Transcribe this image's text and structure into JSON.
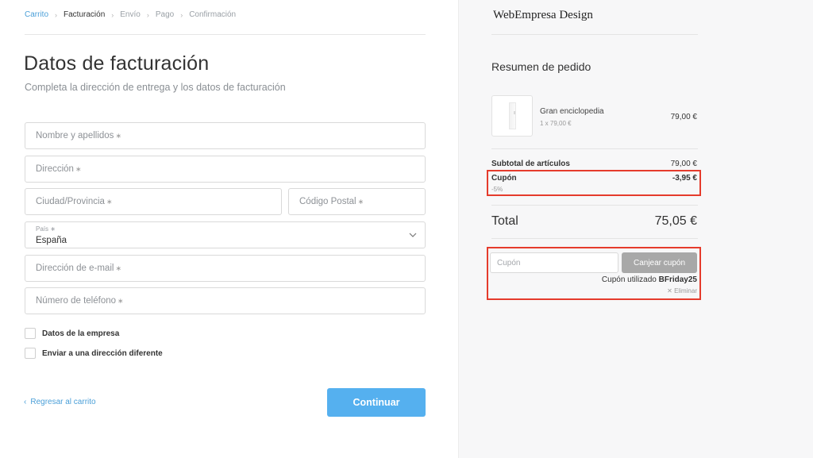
{
  "breadcrumb": [
    {
      "label": "Carrito",
      "state": "link"
    },
    {
      "label": "Facturación",
      "state": "active"
    },
    {
      "label": "Envío",
      "state": "inactive"
    },
    {
      "label": "Pago",
      "state": "inactive"
    },
    {
      "label": "Confirmación",
      "state": "inactive"
    }
  ],
  "form": {
    "title": "Datos de facturación",
    "subtitle": "Completa la dirección de entrega y los datos de facturación",
    "name_placeholder": "Nombre y apellidos",
    "address_placeholder": "Dirección",
    "city_placeholder": "Ciudad/Provincia",
    "postal_placeholder": "Código Postal",
    "country_label": "País",
    "country_value": "España",
    "email_placeholder": "Dirección de e-mail",
    "phone_placeholder": "Número de teléfono",
    "required_mark": "∗",
    "company_checkbox_label": "Datos de la empresa",
    "different_address_label": "Enviar a una dirección diferente",
    "back_label": "Regresar al carrito",
    "continue_label": "Continuar"
  },
  "summary": {
    "store_name": "WebEmpresa Design",
    "title": "Resumen de pedido",
    "product": {
      "name": "Gran enciclopedia",
      "qty_line": "1 x 79,00 €",
      "price": "79,00 €"
    },
    "subtotal_label": "Subtotal de artículos",
    "subtotal_value": "79,00 €",
    "coupon_label": "Cupón",
    "coupon_value": "-3,95 €",
    "coupon_percent": "-5%",
    "total_label": "Total",
    "total_value": "75,05 €",
    "coupon_input_placeholder": "Cupón",
    "redeem_label": "Canjear cupón",
    "coupon_used_prefix": "Cupón utilizado",
    "coupon_code": "BFriday25",
    "remove_label": "✕ Eliminar"
  },
  "colors": {
    "accent": "#55b0ef",
    "link": "#4a9fd8",
    "highlight_box": "#e53b2c",
    "button_disabled": "#a8a8a8"
  }
}
